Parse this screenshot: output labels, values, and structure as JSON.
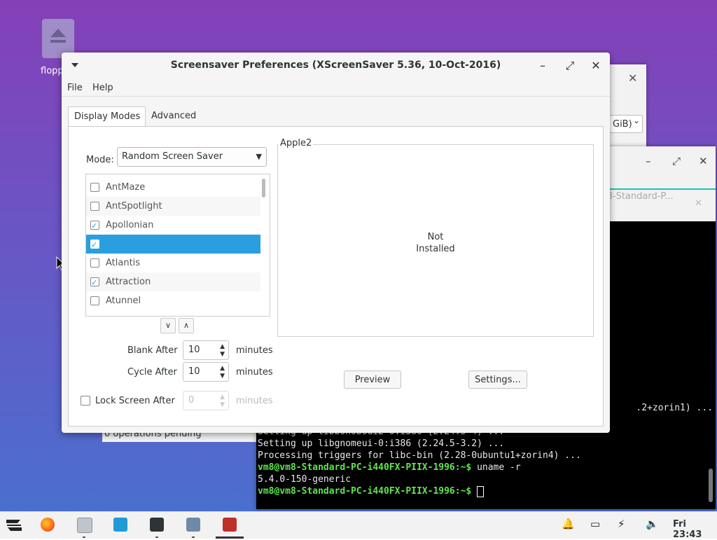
{
  "desktop": {
    "icon_label": "flopp"
  },
  "back_window": {
    "combo_text": "GiB)",
    "status": "0 operations pending"
  },
  "terminal": {
    "tab_title": "m8-Standard-P...",
    "lines": [
      ".2+zorin1) ...",
      "Setting up libbonoboui2-0:i386 (2.24.5-4) ...",
      "Setting up libgnomeui-0:i386 (2.24.5-3.2) ...",
      "Processing triggers for libc-bin (2.28-0ubuntu1+zorin4) ...",
      "uname -r",
      "5.4.0-150-generic"
    ],
    "prompt": "vm8@vm8-Standard-PC-i440FX-PIIX-1996:~$"
  },
  "dialog": {
    "title": "Screensaver Preferences  (XScreenSaver 5.36, 10-Oct-2016)",
    "menu": {
      "file": "File",
      "help": "Help"
    },
    "tabs": {
      "display_modes": "Display Modes",
      "advanced": "Advanced"
    },
    "mode": {
      "label": "Mode:",
      "value": "Random Screen Saver"
    },
    "savers": [
      {
        "name": "AntMaze",
        "checked": false
      },
      {
        "name": "AntSpotlight",
        "checked": false
      },
      {
        "name": "Apollonian",
        "checked": true
      },
      {
        "name": "Apple2",
        "checked": true,
        "selected": true
      },
      {
        "name": "Atlantis",
        "checked": false
      },
      {
        "name": "Attraction",
        "checked": true
      },
      {
        "name": "Atunnel",
        "checked": false
      }
    ],
    "blank_after": {
      "label": "Blank After",
      "value": "10",
      "unit": "minutes"
    },
    "cycle_after": {
      "label": "Cycle After",
      "value": "10",
      "unit": "minutes"
    },
    "lock_after": {
      "label": "Lock Screen After",
      "value": "0",
      "unit": "minutes",
      "checked": false
    },
    "preview": {
      "title": "Apple2",
      "message_line1": "Not",
      "message_line2": "Installed"
    },
    "buttons": {
      "preview": "Preview",
      "settings": "Settings..."
    }
  },
  "taskbar": {
    "clock": "Fri 23:43"
  }
}
